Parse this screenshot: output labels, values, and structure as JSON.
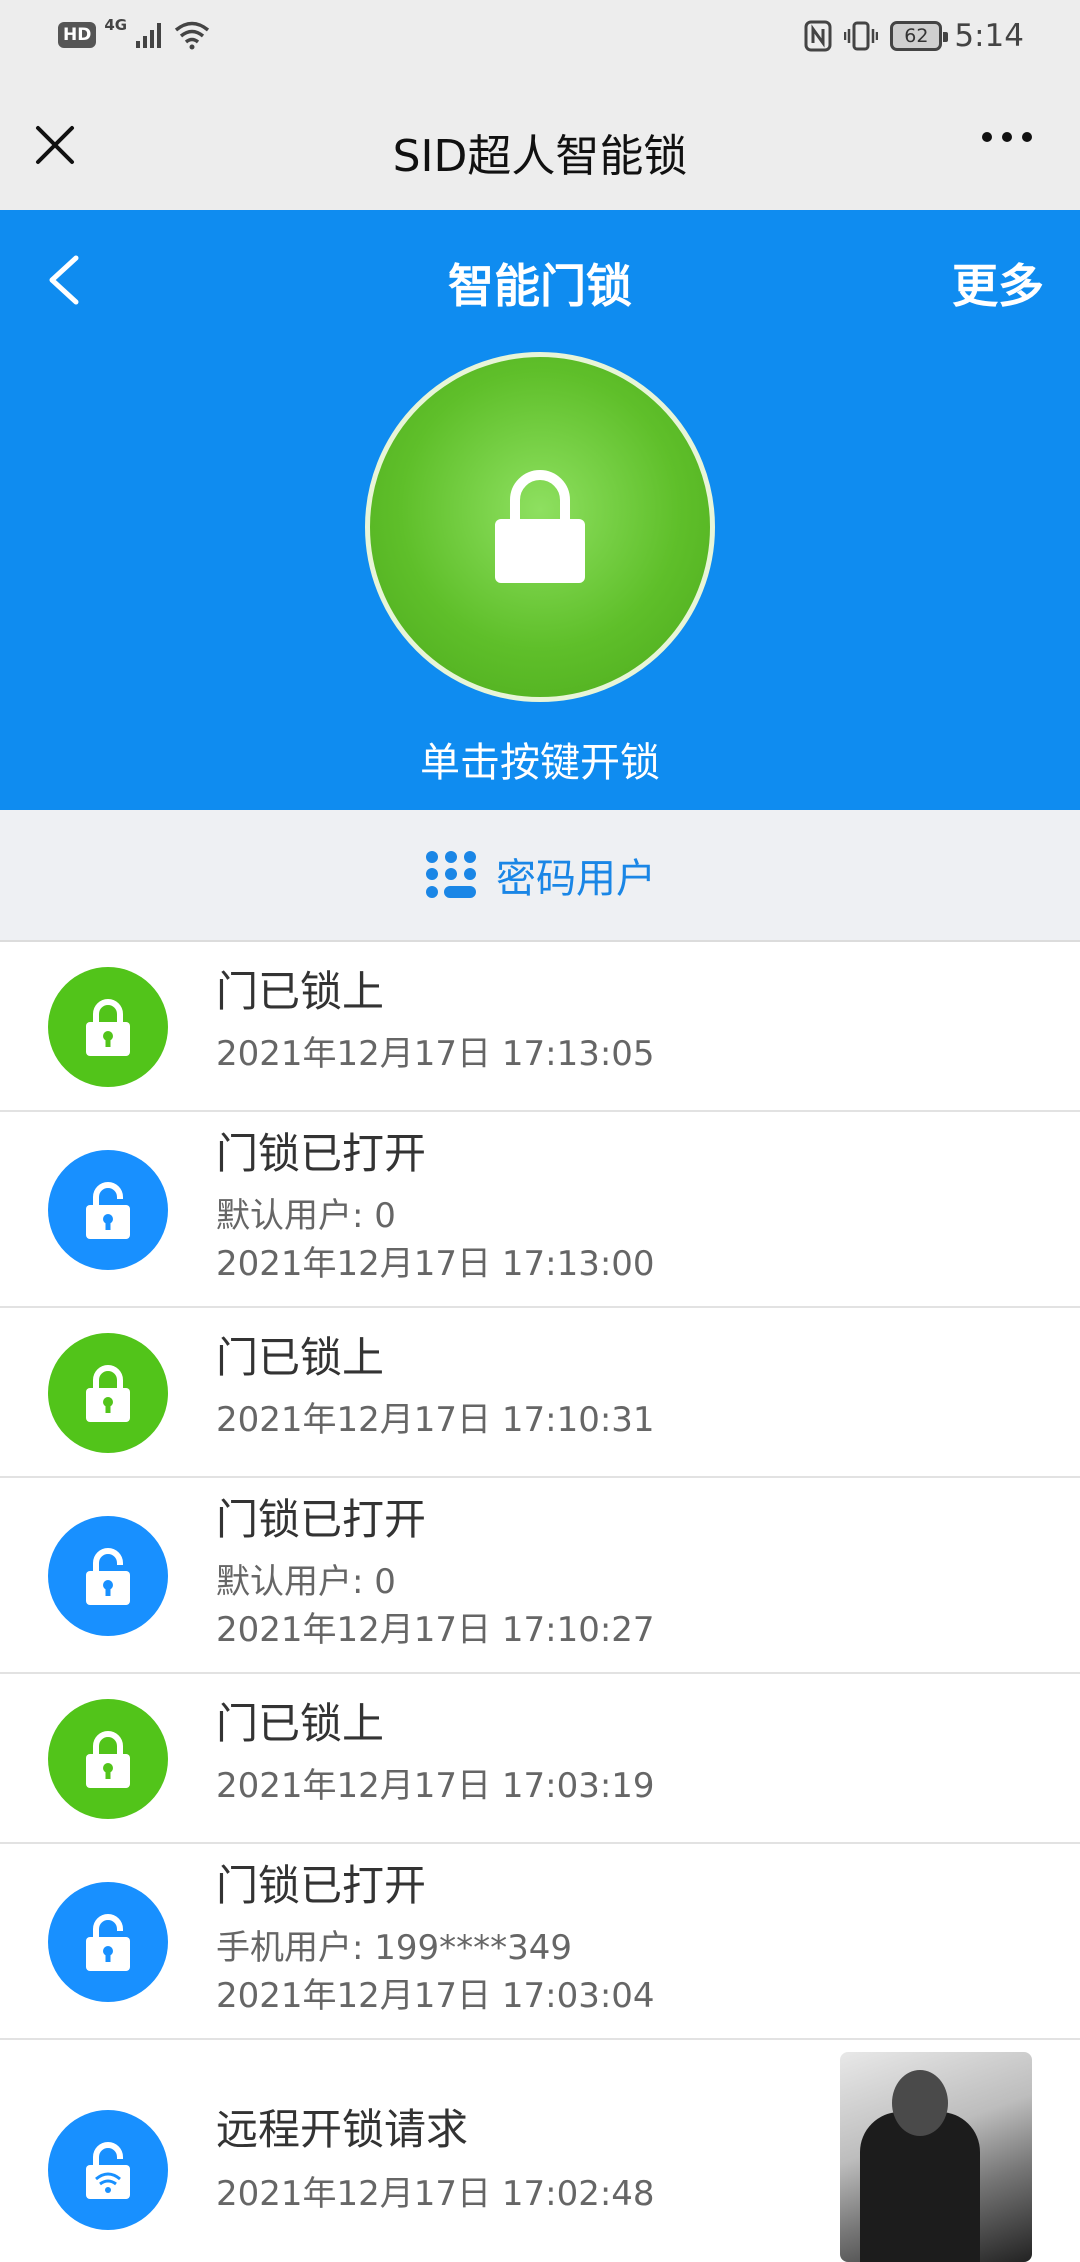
{
  "status_bar": {
    "hd": "HD",
    "network": "4G",
    "battery": "62",
    "time": "5:14"
  },
  "wechat_bar": {
    "title": "SID超人智能锁"
  },
  "header": {
    "title": "智能门锁",
    "more_label": "更多",
    "unlock_label": "单击按键开锁",
    "lock_color": "#52c41a",
    "bg_color": "#0f8cf0"
  },
  "password_users": {
    "label": "密码用户",
    "icon": "keypad-icon"
  },
  "records": [
    {
      "status": "locked",
      "icon": "lock-closed-icon",
      "title": "门已锁上",
      "detail": "",
      "time": "2021年12月17日 17:13:05"
    },
    {
      "status": "unlocked",
      "icon": "lock-open-icon",
      "title": "门锁已打开",
      "detail": "默认用户: 0",
      "time": "2021年12月17日 17:13:00"
    },
    {
      "status": "locked",
      "icon": "lock-closed-icon",
      "title": "门已锁上",
      "detail": "",
      "time": "2021年12月17日 17:10:31"
    },
    {
      "status": "unlocked",
      "icon": "lock-open-icon",
      "title": "门锁已打开",
      "detail": "默认用户: 0",
      "time": "2021年12月17日 17:10:27"
    },
    {
      "status": "locked",
      "icon": "lock-closed-icon",
      "title": "门已锁上",
      "detail": "",
      "time": "2021年12月17日 17:03:19"
    },
    {
      "status": "unlocked",
      "icon": "lock-open-icon",
      "title": "门锁已打开",
      "detail": "手机用户: 199****349",
      "time": "2021年12月17日 17:03:04"
    },
    {
      "status": "remote",
      "icon": "remote-unlock-icon",
      "title": "远程开锁请求",
      "detail": "",
      "time": "2021年12月17日 17:02:48"
    }
  ]
}
